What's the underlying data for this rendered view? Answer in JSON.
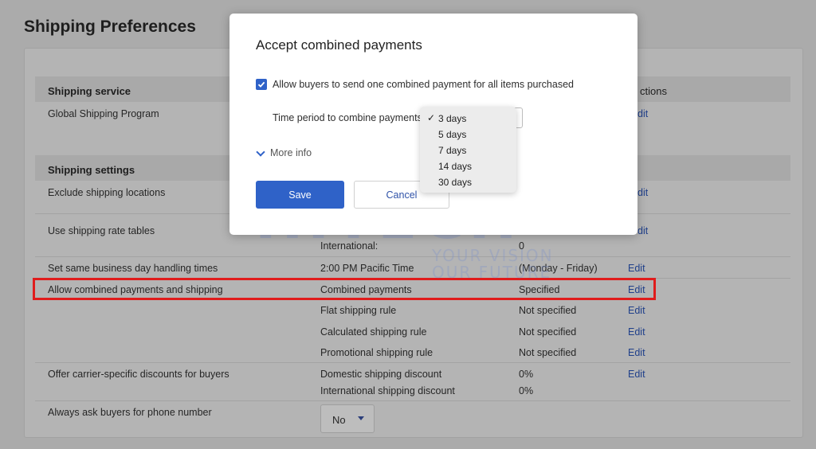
{
  "page": {
    "title": "Shipping Preferences"
  },
  "sections": {
    "service_header": "Shipping service",
    "actions_header": "ctions",
    "settings_header": "Shipping settings"
  },
  "rows": {
    "global_shipping": {
      "label": "Global Shipping Program",
      "action": "dit"
    },
    "exclude_locations": {
      "label": "Exclude shipping locations",
      "action": "dit"
    },
    "rate_tables": {
      "label": "Use shipping rate tables",
      "action": "dit",
      "col2": "International:",
      "col3": "0"
    },
    "handling_times": {
      "label": "Set same business day handling times",
      "col2": "2:00 PM Pacific Time",
      "col3": "(Monday - Friday)",
      "action": "Edit"
    },
    "combined_payments": {
      "label": "Allow combined payments and shipping",
      "col2": "Combined payments",
      "col3": "Specified",
      "action": "Edit"
    },
    "flat_rule": {
      "col2": "Flat shipping rule",
      "col3": "Not specified",
      "action": "Edit"
    },
    "calculated_rule": {
      "col2": "Calculated shipping rule",
      "col3": "Not specified",
      "action": "Edit"
    },
    "promotional_rule": {
      "col2": "Promotional shipping rule",
      "col3": "Not specified",
      "action": "Edit"
    },
    "carrier_discounts": {
      "label": "Offer carrier-specific discounts for buyers",
      "col2": "Domestic shipping discount",
      "col3": "0%",
      "action": "Edit"
    },
    "intl_discount": {
      "col2": "International shipping discount",
      "col3": "0%"
    },
    "phone_number": {
      "label": "Always ask buyers for phone number",
      "select_value": "No"
    }
  },
  "modal": {
    "title": "Accept combined payments",
    "checkbox_label": "Allow buyers to send one combined payment for all items purchased",
    "checkbox_checked": true,
    "period_label": "Time period to combine payments",
    "more_info": "More info",
    "save_label": "Save",
    "cancel_label": "Cancel"
  },
  "dropdown": {
    "options": [
      "3 days",
      "5 days",
      "7 days",
      "14 days",
      "30 days"
    ],
    "selected": "3 days",
    "check_glyph": "✓"
  },
  "watermark": {
    "big": "HITECH",
    "line1": "YOUR VISION",
    "line2": "OUR FUTURE"
  },
  "colors": {
    "accent": "#2f62c8",
    "highlight_border": "#e01c1c",
    "link": "#1f3f8a"
  }
}
